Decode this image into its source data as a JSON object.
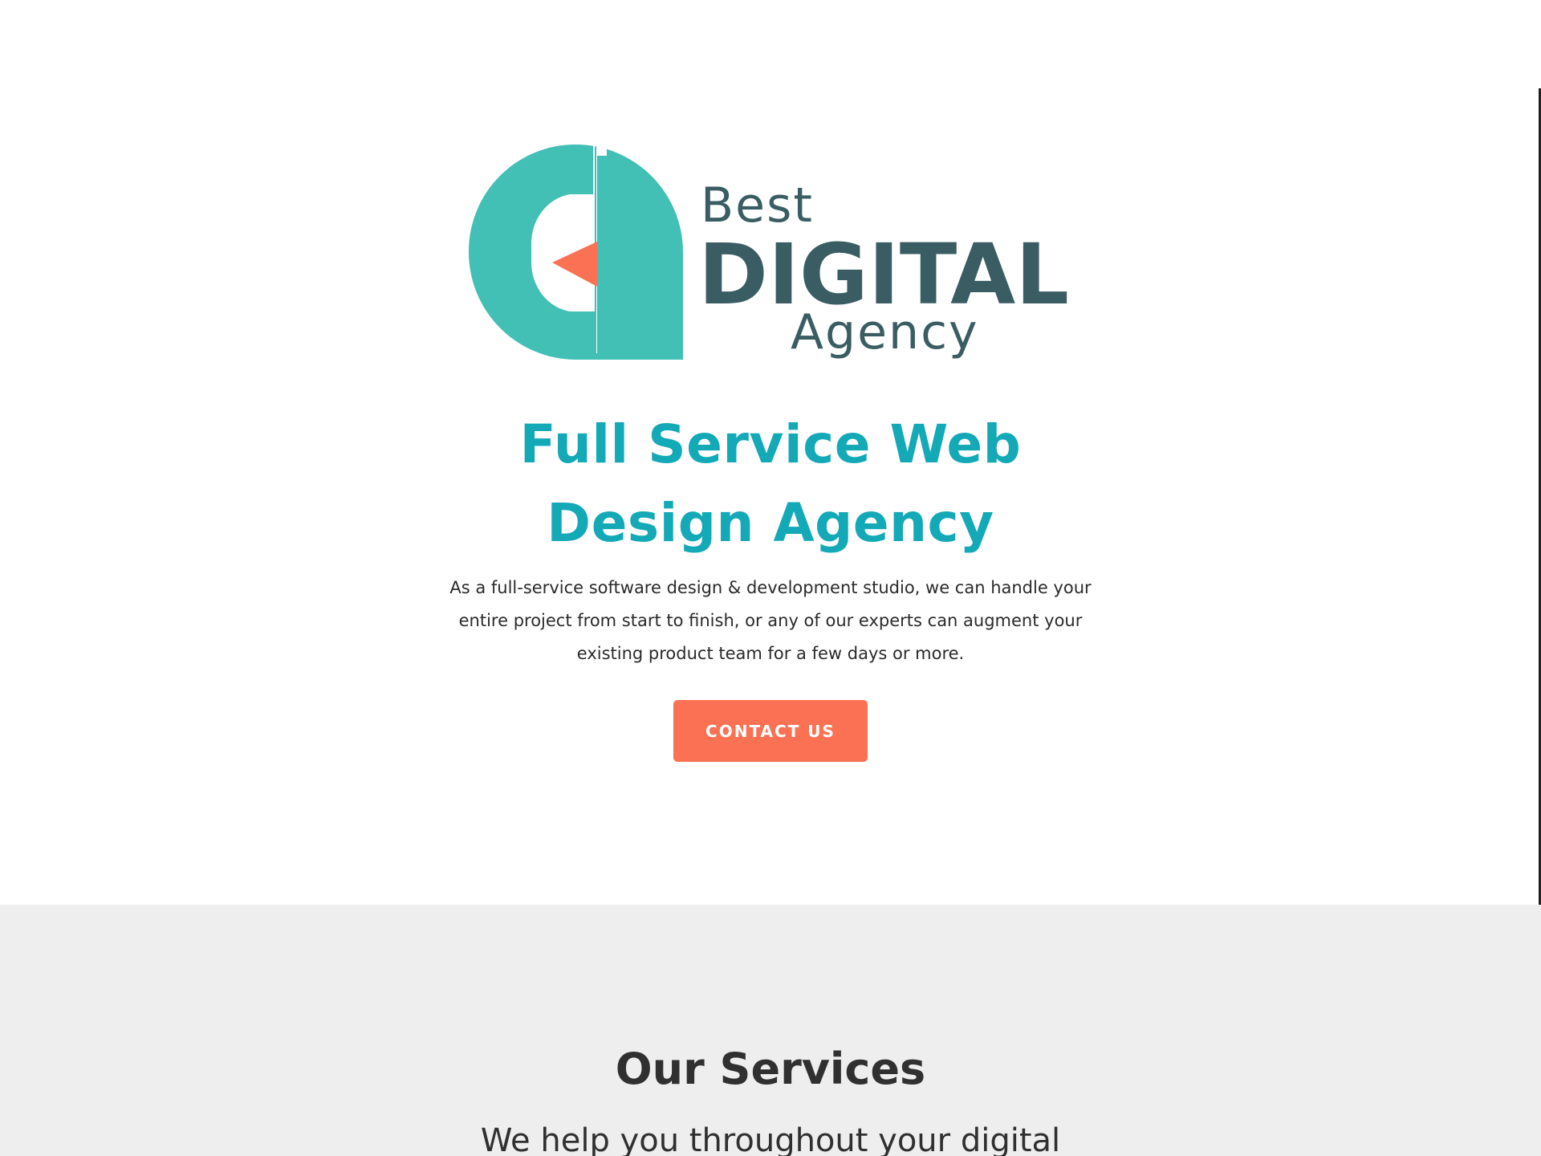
{
  "logo": {
    "line1": "Best",
    "line2": "DIGITAL",
    "line3": "Agency",
    "icon": "d-play-logo-icon",
    "colors": {
      "teal": "#43c0b5",
      "coral": "#fa7153",
      "dark": "#3a5d63"
    }
  },
  "hero": {
    "headline": "Full Service Web Design Agency",
    "intro": "As a full-service software design & development studio, we can handle your entire project from start to finish, or any of our experts can augment your existing product team for a few days or more.",
    "cta_label": "CONTACT US",
    "colors": {
      "headline": "#14a9b7",
      "cta": "#fa7153"
    }
  },
  "services": {
    "title": "Our Services",
    "subtitle": "We help you throughout your digital",
    "background": "#eeeeee"
  }
}
